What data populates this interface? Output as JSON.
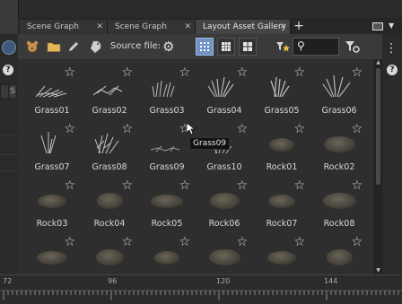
{
  "tabs": [
    {
      "label": "Scene Graph Details",
      "active": false
    },
    {
      "label": "Scene Graph Layers",
      "active": false
    },
    {
      "label": "Layout Asset Gallery",
      "active": true
    }
  ],
  "tab_add_label": "+",
  "toolbar": {
    "source_label": "Source file:",
    "icons": [
      "asset-bear-icon",
      "folder-icon",
      "pencil-icon",
      "tag-icon",
      "gear-icon"
    ],
    "view_modes": [
      "small-grid-icon",
      "medium-grid-icon",
      "large-grid-icon"
    ],
    "selected_view": "small-grid-icon"
  },
  "gallery": {
    "items": [
      {
        "label": "Grass01",
        "kind": "grass"
      },
      {
        "label": "Grass02",
        "kind": "grass"
      },
      {
        "label": "Grass03",
        "kind": "grass"
      },
      {
        "label": "Grass04",
        "kind": "grass"
      },
      {
        "label": "Grass05",
        "kind": "grass"
      },
      {
        "label": "Grass06",
        "kind": "grass"
      },
      {
        "label": "Grass07",
        "kind": "grass"
      },
      {
        "label": "Grass08",
        "kind": "grass"
      },
      {
        "label": "Grass09",
        "kind": "grass"
      },
      {
        "label": "Grass10",
        "kind": "grass"
      },
      {
        "label": "Rock01",
        "kind": "rock"
      },
      {
        "label": "Rock02",
        "kind": "rock"
      },
      {
        "label": "Rock03",
        "kind": "rock"
      },
      {
        "label": "Rock04",
        "kind": "rock"
      },
      {
        "label": "Rock05",
        "kind": "rock"
      },
      {
        "label": "Rock06",
        "kind": "rock"
      },
      {
        "label": "Rock07",
        "kind": "rock"
      },
      {
        "label": "Rock08",
        "kind": "rock"
      },
      {
        "label": "",
        "kind": "rock"
      },
      {
        "label": "",
        "kind": "rock"
      },
      {
        "label": "",
        "kind": "rock"
      },
      {
        "label": "",
        "kind": "rock"
      },
      {
        "label": "",
        "kind": "rock"
      },
      {
        "label": "",
        "kind": "rock"
      }
    ]
  },
  "tooltip": "Grass09",
  "timeline": {
    "tick_labels": [
      "72",
      "96",
      "120",
      "144"
    ]
  },
  "left_strip": {
    "tab_label": "S"
  },
  "colors": {
    "accent": "#6f93c3",
    "icon_yellow": "#e3b75a"
  }
}
